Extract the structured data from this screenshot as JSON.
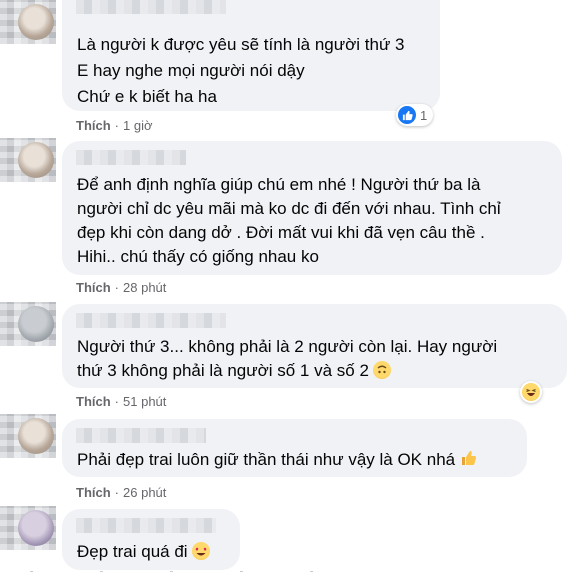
{
  "comments": [
    {
      "lines": [
        "Là người k được yêu sẽ tính là người thứ 3",
        "E hay nghe mọi người nói dậy",
        "Chứ e k biết ha ha"
      ],
      "like_label": "Thích",
      "time": "1 giờ",
      "reaction": {
        "icon": "thumbs-up-icon",
        "count": "1"
      }
    },
    {
      "lines": [
        "Để anh định nghĩa giúp chú em nhé ! Người thứ ba là",
        "người chỉ dc yêu mãi mà ko dc đi đến với nhau. Tình chỉ",
        "đẹp khi còn dang dở . Đời mất vui khi đã vẹn câu thề .",
        "Hihi.. chú thấy có giống nhau ko"
      ],
      "like_label": "Thích",
      "time": "28 phút"
    },
    {
      "lines": [
        "Người thứ 3... không phải là 2 người còn lại. Hay người",
        "thứ 3 không phải là người số 1 và số 2"
      ],
      "like_label": "Thích",
      "time": "51 phút",
      "reaction": {
        "icon": "haha-icon"
      }
    },
    {
      "lines": [
        "Phải đẹp trai luôn giữ thần thái như vậy là OK nhá"
      ],
      "like_label": "Thích",
      "time": "26 phút"
    },
    {
      "lines": [
        "Đẹp trai quá đi"
      ],
      "like_label": "",
      "time": ""
    }
  ],
  "colors": {
    "bubble": "#f0f2f5",
    "meta": "#65676b",
    "like_blue": "#1877f2"
  }
}
